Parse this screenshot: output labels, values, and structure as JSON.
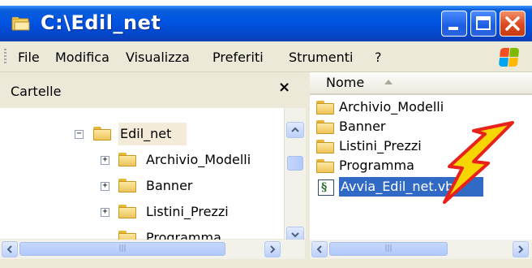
{
  "window": {
    "title": "C:\\Edil_net"
  },
  "menu": [
    "File",
    "Modifica",
    "Visualizza",
    "Preferiti",
    "Strumenti",
    "?"
  ],
  "folders_pane": {
    "title": "Cartelle",
    "close_glyph": "×",
    "tree": [
      {
        "label": "Edil_net",
        "toggle": "−",
        "level": 0
      },
      {
        "label": "Archivio_Modelli",
        "toggle": "+",
        "level": 1
      },
      {
        "label": "Banner",
        "toggle": "+",
        "level": 1
      },
      {
        "label": "Listini_Prezzi",
        "toggle": "+",
        "level": 1
      },
      {
        "label": "Programma",
        "toggle": "",
        "level": 1
      }
    ]
  },
  "files_pane": {
    "column_name": "Nome",
    "items": [
      {
        "name": "Archivio_Modelli",
        "type": "folder"
      },
      {
        "name": "Banner",
        "type": "folder"
      },
      {
        "name": "Listini_Prezzi",
        "type": "folder"
      },
      {
        "name": "Programma",
        "type": "folder"
      },
      {
        "name": "Avvia_Edil_net.vbs",
        "type": "vbs",
        "selected": true
      }
    ]
  },
  "colors": {
    "title_bar": "#0054e3",
    "selection": "#316ac5",
    "folder": "#eec55b",
    "arrow": "#f7d500"
  }
}
